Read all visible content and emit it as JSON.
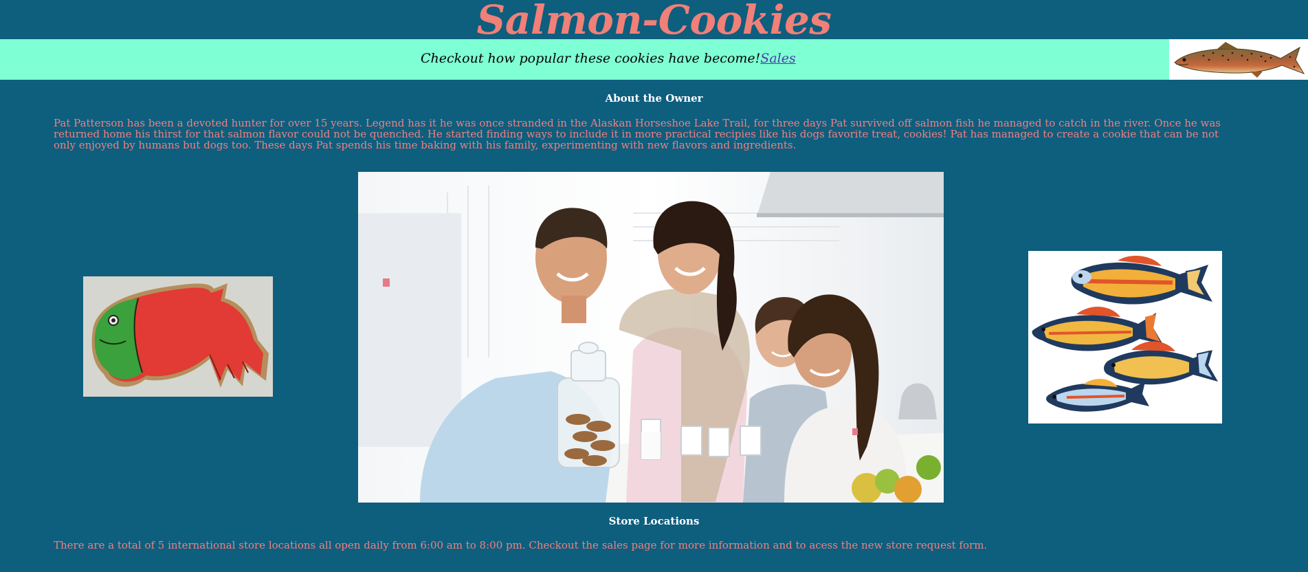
{
  "header": {
    "title": "Salmon-Cookies"
  },
  "banner": {
    "text": "Checkout how popular these cookies have become!",
    "link_label": "Sales",
    "image_icon": "salmon-fish-icon"
  },
  "about": {
    "heading": "About the Owner",
    "body": "Pat Patterson has been a devoted hunter for over 15 years. Legend has it he was once stranded in the Alaskan Horseshoe Lake Trail, for three days Pat survived off salmon fish he managed to catch in the river. Once he was returned home his thirst for that salmon flavor could not be quenched. He started finding ways to include it in more practical recipies like his dogs favorite treat, cookies! Pat has managed to create a cookie that can be not only enjoyed by humans but dogs too. These days Pat spends his time baking with his family, experimenting with new flavors and ingredients."
  },
  "gallery": {
    "left_image": "salmon-cookie-photo",
    "center_image": "family-kitchen-photo",
    "right_image": "fish-illustration"
  },
  "stores": {
    "heading": "Store Locations",
    "body": "There are a total of 5 international store locations all open daily from 6:00 am to 8:00 pm. Checkout the sales page for more information and to acess the new store request form."
  },
  "colors": {
    "background": "#0e5e7e",
    "title": "#f08078",
    "banner": "#7fffd4",
    "paragraph": "#f08080",
    "heading": "#ffffff",
    "link": "#4a3aa8"
  }
}
